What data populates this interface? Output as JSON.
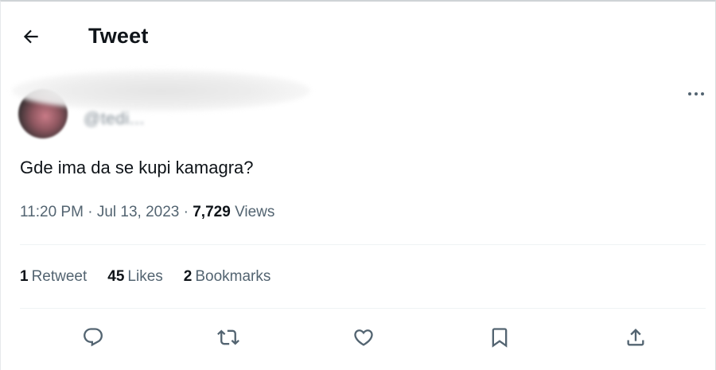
{
  "header": {
    "title": "Tweet",
    "back_icon": "arrow-left-icon"
  },
  "author": {
    "handle": "@tedi...",
    "avatar_icon": "avatar",
    "more_icon": "more-horizontal-icon"
  },
  "tweet": {
    "text": "Gde ima da se kupi kamagra?",
    "time": "11:20 PM",
    "separator": " · ",
    "date": "Jul 13, 2023",
    "views_count": "7,729",
    "views_label": "Views"
  },
  "stats": {
    "retweets_count": "1",
    "retweets_label": "Retweet",
    "likes_count": "45",
    "likes_label": "Likes",
    "bookmarks_count": "2",
    "bookmarks_label": "Bookmarks"
  },
  "actions": [
    {
      "icon": "reply-icon"
    },
    {
      "icon": "retweet-icon"
    },
    {
      "icon": "like-icon"
    },
    {
      "icon": "bookmark-icon"
    },
    {
      "icon": "share-icon"
    }
  ],
  "colors": {
    "text_primary": "#0f1419",
    "text_secondary": "#536471",
    "divider": "#eff3f4"
  }
}
